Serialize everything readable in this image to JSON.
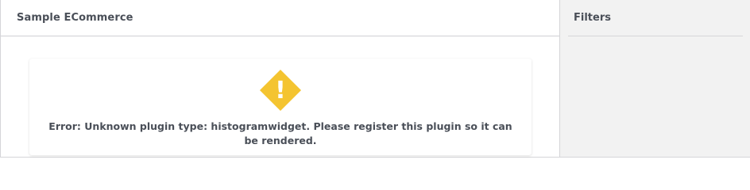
{
  "main": {
    "title": "Sample ECommerce",
    "error": {
      "icon": "warning-icon",
      "icon_symbol": "!",
      "icon_color": "#f4c430",
      "message": "Error: Unknown plugin type: histogramwidget. Please register this plugin so it can be rendered."
    }
  },
  "filters": {
    "title": "Filters"
  }
}
